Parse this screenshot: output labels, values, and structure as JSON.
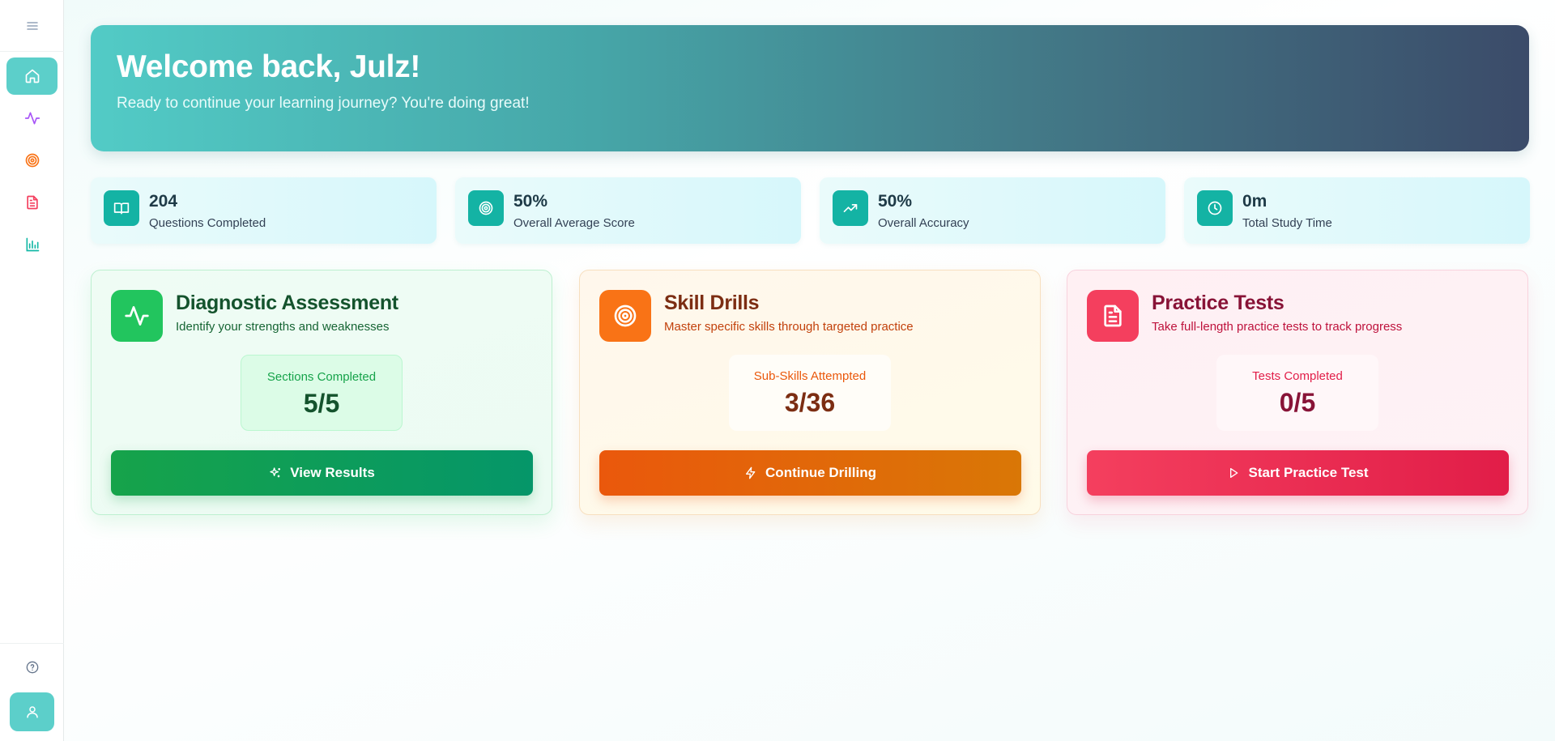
{
  "sidebar": {
    "items": [
      {
        "icon": "home-icon",
        "active": true
      },
      {
        "icon": "activity-icon",
        "color": "#a855f7"
      },
      {
        "icon": "target-icon",
        "color": "#f97316"
      },
      {
        "icon": "document-icon",
        "color": "#f43f5e"
      },
      {
        "icon": "bar-chart-icon",
        "color": "#14b8a6"
      }
    ]
  },
  "hero": {
    "title": "Welcome back, Julz!",
    "subtitle": "Ready to continue your learning journey? You're doing great!"
  },
  "stats": [
    {
      "value": "204",
      "label": "Questions Completed",
      "icon": "book-icon"
    },
    {
      "value": "50%",
      "label": "Overall Average Score",
      "icon": "target-icon"
    },
    {
      "value": "50%",
      "label": "Overall Accuracy",
      "icon": "trending-up-icon"
    },
    {
      "value": "0m",
      "label": "Total Study Time",
      "icon": "clock-icon"
    }
  ],
  "cards": [
    {
      "title": "Diagnostic Assessment",
      "subtitle": "Identify your strengths and weaknesses",
      "metric_label": "Sections Completed",
      "metric_value": "5/5",
      "button": "View Results",
      "accent": "#22c55e"
    },
    {
      "title": "Skill Drills",
      "subtitle": "Master specific skills through targeted practice",
      "metric_label": "Sub-Skills Attempted",
      "metric_value": "3/36",
      "button": "Continue Drilling",
      "accent": "#f97316"
    },
    {
      "title": "Practice Tests",
      "subtitle": "Take full-length practice tests to track progress",
      "metric_label": "Tests Completed",
      "metric_value": "0/5",
      "button": "Start Practice Test",
      "accent": "#f43f5e"
    }
  ]
}
